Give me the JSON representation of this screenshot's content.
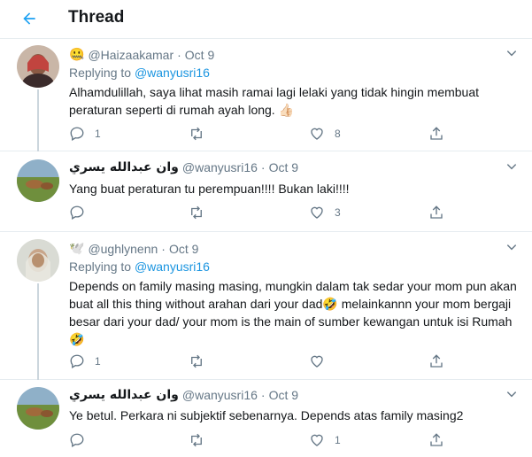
{
  "header": {
    "title": "Thread"
  },
  "tweets": [
    {
      "display_name": "",
      "name_emoji": "🤐",
      "handle": "@Haizaakamar",
      "date": "Oct 9",
      "replying_label": "Replying to",
      "replying_to": "@wanyusri16",
      "text": "Alhamdulillah, saya lihat masih ramai lagi lelaki yang tidak hingin membuat peraturan seperti di rumah ayah long. 👍🏻",
      "replies": "1",
      "retweets": "",
      "likes": "8"
    },
    {
      "display_name": "وان عبدالله يسري",
      "name_emoji": "",
      "handle": "@wanyusri16",
      "date": "Oct 9",
      "text": "Yang buat peraturan tu perempuan!!!! Bukan laki!!!!",
      "replies": "",
      "retweets": "",
      "likes": "3"
    },
    {
      "display_name": "",
      "name_emoji": "🕊️",
      "handle": "@ughlynenn",
      "date": "Oct 9",
      "replying_label": "Replying to",
      "replying_to": "@wanyusri16",
      "text": "Depends on family masing masing, mungkin dalam tak sedar your mom pun akan buat all this thing without arahan dari your dad🤣 melainkannn your mom bergaji besar dari your dad/ your mom is the main of sumber kewangan untuk isi Rumah 🤣",
      "replies": "1",
      "retweets": "",
      "likes": ""
    },
    {
      "display_name": "وان عبدالله يسري",
      "name_emoji": "",
      "handle": "@wanyusri16",
      "date": "Oct 9",
      "text": "Ye betul. Perkara ni subjektif sebenarnya. Depends atas family masing2",
      "replies": "",
      "retweets": "",
      "likes": "1"
    }
  ],
  "colors": {
    "accent": "#1da1f2",
    "link": "#1b95e0",
    "secondary_text": "#657786",
    "divider": "#e6ecf0",
    "thread_line": "#ccd6dd"
  },
  "icons": {
    "back": "arrow-left-icon",
    "more": "chevron-down-icon",
    "reply": "reply-icon",
    "retweet": "retweet-icon",
    "like": "heart-icon",
    "share": "share-icon"
  }
}
